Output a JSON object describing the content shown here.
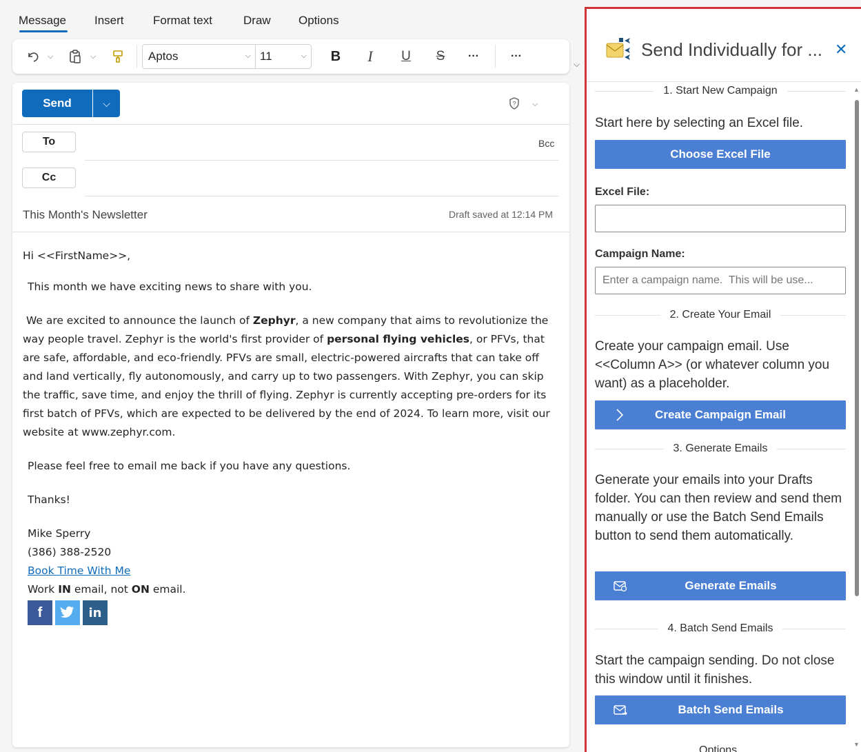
{
  "ribbon": {
    "tabs": [
      {
        "label": "Message",
        "active": true
      },
      {
        "label": "Insert"
      },
      {
        "label": "Format text"
      },
      {
        "label": "Draw"
      },
      {
        "label": "Options"
      }
    ],
    "font_name": "Aptos",
    "font_size": "11",
    "more_label": "···"
  },
  "compose": {
    "send_label": "Send",
    "to_label": "To",
    "cc_label": "Cc",
    "bcc_label": "Bcc",
    "subject": "This Month's Newsletter",
    "draft_status": "Draft saved at 12:14 PM",
    "body": {
      "greeting": "Hi <<FirstName>>,",
      "intro": "This month we have exciting news to share with you.",
      "p1_a": "We are excited to announce the launch of ",
      "p1_b": "Zephyr",
      "p1_c": ", a new company that aims to revolutionize the way people travel. Zephyr is the world's first provider of ",
      "p1_d": "personal flying vehicles",
      "p1_e": ", or PFVs, that are safe, affordable, and eco-friendly. PFVs are small, electric-powered aircrafts that can take off and land vertically, fly autonomously, and carry up to two passengers. With Zephyr, you can skip the traffic, save time, and enjoy the thrill of flying. Zephyr is currently accepting pre-orders for its first batch of PFVs, which are expected to be delivered by the end of 2024. To learn more, visit our website at www.zephyr.com.",
      "closing_q": "Please feel free to email me back if you have any questions.",
      "thanks": "Thanks!",
      "sig_name": "Mike Sperry",
      "sig_phone": "(386) 388-2520",
      "sig_link": "Book Time With Me",
      "motto_a": "Work ",
      "motto_b": "IN",
      "motto_c": " email, not ",
      "motto_d": "ON",
      "motto_e": " email.",
      "social": {
        "facebook": "f",
        "twitter": "",
        "linkedin": "in"
      }
    }
  },
  "pane": {
    "title": "Send Individually for ...",
    "close": "✕",
    "sections": {
      "s1": "1. Start New Campaign",
      "s1_text": "Start here by selecting an Excel file.",
      "choose_btn": "Choose Excel File",
      "excel_label": "Excel File:",
      "excel_value": "",
      "campaign_label": "Campaign Name:",
      "campaign_placeholder": "Enter a campaign name.  This will be use...",
      "s2": "2. Create Your Email",
      "s2_text": "Create your campaign email. Use <<Column A>> (or whatever column you want) as a placeholder.",
      "create_btn": "Create Campaign Email",
      "s3": "3. Generate Emails",
      "s3_text": "Generate your emails into your Drafts folder. You can then review and send them manually or use the Batch Send Emails button to send them automatically.",
      "generate_btn": "Generate Emails",
      "s4": "4. Batch Send Emails",
      "s4_text": "Start the campaign sending. Do not close this window until it finishes.",
      "batch_btn": "Batch Send Emails",
      "options_peek": "Options"
    }
  },
  "colors": {
    "accent": "#0f6cbd",
    "pane_button": "#4a7fd3",
    "pane_border": "#d13438",
    "facebook": "#3b5998",
    "twitter": "#55acee",
    "linkedin": "#2d5f8b"
  }
}
